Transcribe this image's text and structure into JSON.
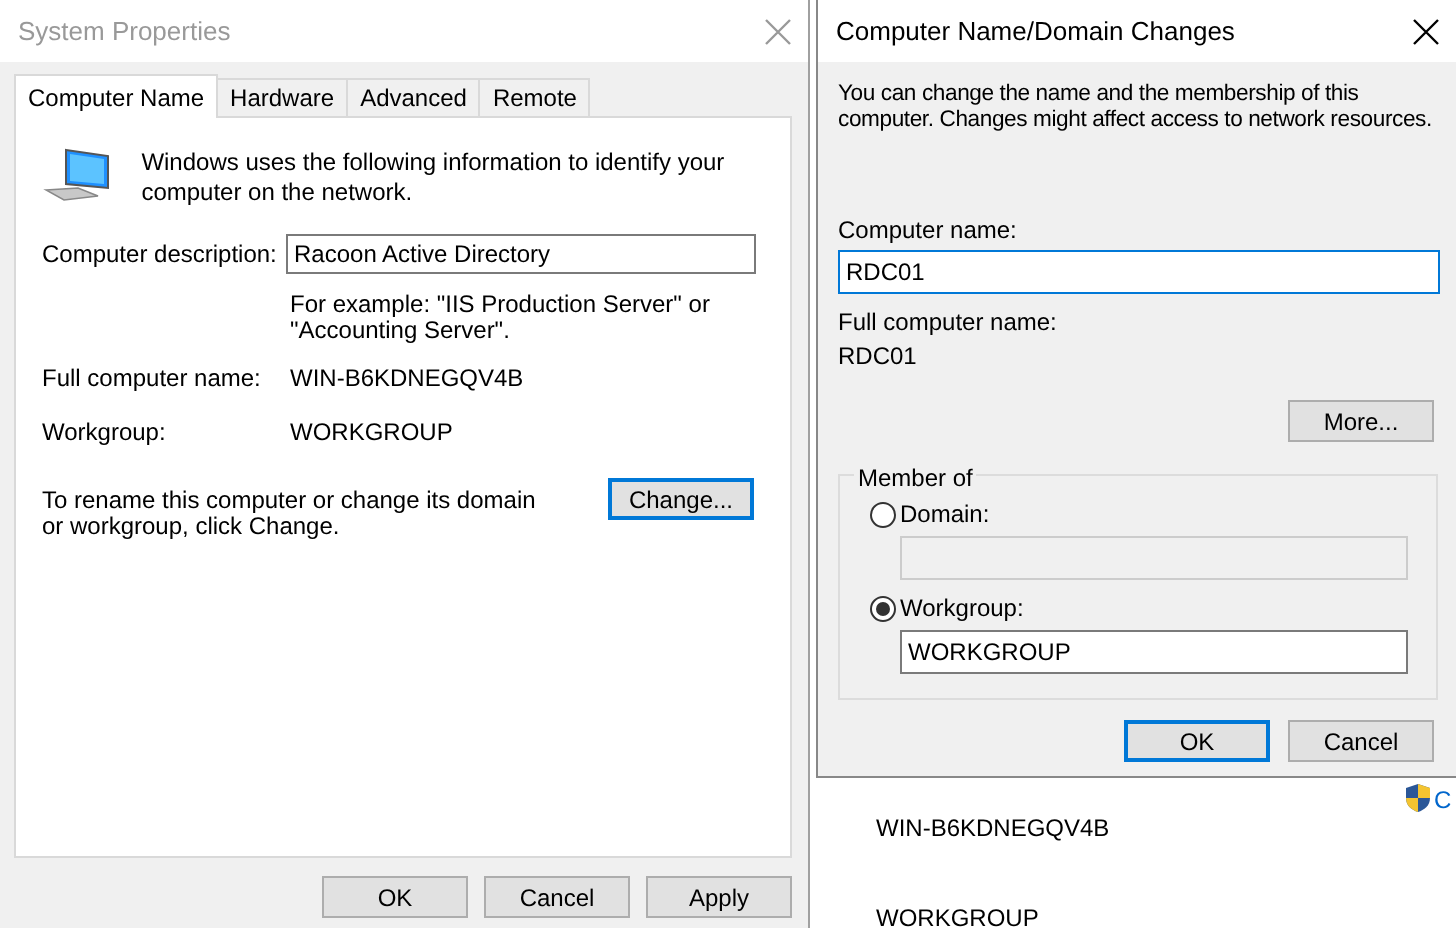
{
  "background": {
    "texts": [
      "WIN-B6KDNEGQV4B",
      "WORKGROUP"
    ],
    "link": "C"
  },
  "system_properties": {
    "title": "System Properties",
    "active": false,
    "tabs": [
      {
        "label": "Computer Name",
        "selected": true
      },
      {
        "label": "Hardware",
        "selected": false
      },
      {
        "label": "Advanced",
        "selected": false
      },
      {
        "label": "Remote",
        "selected": false
      }
    ],
    "intro": "Windows uses the following information to identify your computer on the network.",
    "description": {
      "label": "Computer description:",
      "value": "Racoon Active Directory"
    },
    "hint": "For example: \"IIS Production Server\" or \"Accounting Server\".",
    "info": [
      {
        "label": "Full computer name:",
        "value": "WIN-B6KDNEGQV4B"
      },
      {
        "label": "Workgroup:",
        "value": "WORKGROUP"
      }
    ],
    "rename_text": "To rename this computer or change its domain or workgroup, click Change.",
    "change_button": {
      "label": "Change...",
      "default": true
    },
    "buttons": [
      {
        "label": "OK",
        "default": false
      },
      {
        "label": "Cancel",
        "default": false
      },
      {
        "label": "Apply",
        "default": false
      }
    ]
  },
  "dialog": {
    "title": "Computer Name/Domain Changes",
    "active": true,
    "intro": "You can change the name and the membership of this computer. Changes might affect access to network resources.",
    "computer_name": {
      "label": "Computer name:",
      "value": "RDC01",
      "focused": true
    },
    "full_name": {
      "label": "Full computer name:",
      "value": "RDC01"
    },
    "more_button": {
      "label": "More...",
      "default": false
    },
    "member_of": {
      "title": "Member of",
      "options": [
        {
          "label": "Domain:",
          "selected": false
        },
        {
          "label": "Workgroup:",
          "selected": true,
          "value": "WORKGROUP"
        }
      ]
    },
    "buttons": [
      {
        "label": "OK",
        "default": true
      },
      {
        "label": "Cancel",
        "default": false
      }
    ]
  }
}
